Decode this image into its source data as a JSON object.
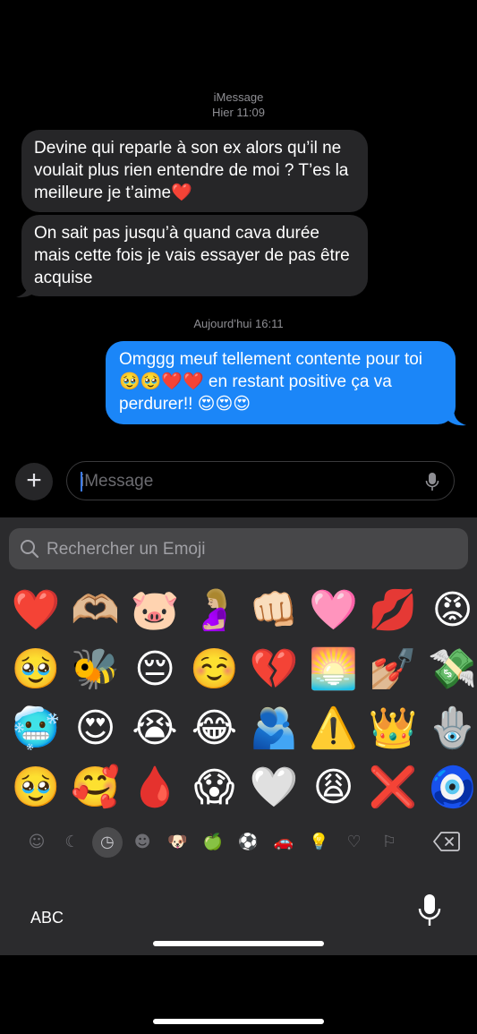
{
  "conversation": {
    "service_label": "iMessage",
    "time_header_1": "Hier 11:09",
    "time_header_2": "Aujourd’hui 16:11",
    "messages": [
      {
        "direction": "incoming",
        "text": "Devine qui reparle à son ex alors qu’il ne voulait plus rien entendre de moi ? T’es la meilleure je t’aime❤️"
      },
      {
        "direction": "incoming",
        "text": "On sait pas jusqu’à quand cava durée mais cette fois je vais essayer de pas être acquise"
      },
      {
        "direction": "outgoing",
        "text": "Omggg meuf tellement contente pour toi 🥹🥹❤️❤️ en restant positive ça va perdurer!! 😍😍😍"
      }
    ]
  },
  "composer": {
    "add_label": "+",
    "placeholder": "iMessage"
  },
  "keyboard": {
    "search_placeholder": "Rechercher un Emoji",
    "emoji_rows": [
      [
        "❤️",
        "🫶🏼",
        "🐷",
        "🤰🏼",
        "👊🏻",
        "🩷",
        "💋",
        "😡"
      ],
      [
        "🥹",
        "🐝",
        "😔",
        "☺️",
        "💔",
        "🌅",
        "💅🏼",
        "💸"
      ],
      [
        "🥶",
        "😍",
        "😭",
        "😂",
        "🫂",
        "⚠️",
        "👑",
        "🪬"
      ],
      [
        "🥹",
        "🥰",
        "🩸",
        "😱",
        "🤍",
        "😩",
        "❌",
        "🧿"
      ]
    ],
    "categories": [
      {
        "name": "memoji",
        "glyph": "☺"
      },
      {
        "name": "moon",
        "glyph": "☾"
      },
      {
        "name": "recents",
        "glyph": "◷",
        "selected": true
      },
      {
        "name": "smileys",
        "glyph": "☻"
      },
      {
        "name": "animals",
        "glyph": "🐶"
      },
      {
        "name": "food",
        "glyph": "🍏"
      },
      {
        "name": "activity",
        "glyph": "⚽"
      },
      {
        "name": "travel",
        "glyph": "🚗"
      },
      {
        "name": "objects",
        "glyph": "💡"
      },
      {
        "name": "symbols",
        "glyph": "♡"
      },
      {
        "name": "flags",
        "glyph": "⚐"
      }
    ],
    "abc_label": "ABC"
  }
}
